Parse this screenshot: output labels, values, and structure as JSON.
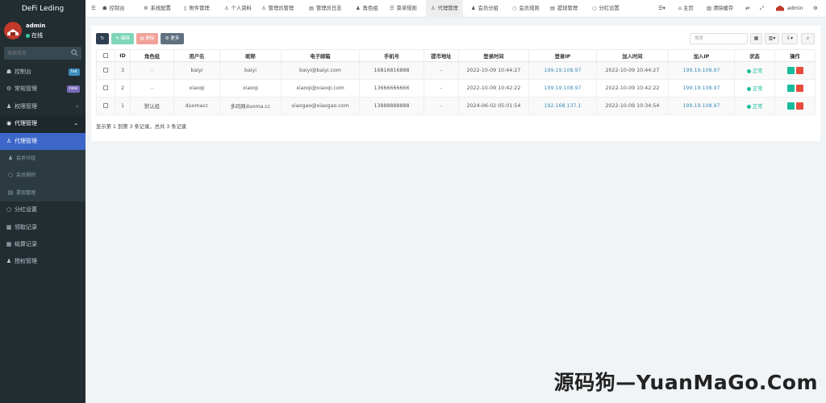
{
  "app": {
    "brand": "DeFi Leding"
  },
  "user": {
    "name": "admin",
    "status": "在线"
  },
  "sidebar": {
    "search_placeholder": "搜索菜单",
    "items": [
      {
        "label": "控制台",
        "icon": "dashboard-icon",
        "badge": "hot"
      },
      {
        "label": "常规管理",
        "icon": "gears-icon",
        "badge": "new"
      },
      {
        "label": "权限管理",
        "icon": "group-icon",
        "chevron": "‹"
      },
      {
        "label": "代理管理",
        "icon": "user-circle-icon",
        "chevron": "⌄"
      },
      {
        "label": "代理管理",
        "icon": "user-icon",
        "active": true
      },
      {
        "label": "会员分组",
        "icon": "users-icon",
        "sub": true
      },
      {
        "label": "会员规则",
        "icon": "circle-icon",
        "sub": true
      },
      {
        "label": "提现管理",
        "icon": "list-icon",
        "sub": true
      },
      {
        "label": "分红设置",
        "icon": "circle-icon"
      },
      {
        "label": "领取记录",
        "icon": "table-icon"
      },
      {
        "label": "结算记录",
        "icon": "table-icon"
      },
      {
        "label": "授权管理",
        "icon": "users-icon"
      }
    ]
  },
  "topnav": {
    "tabs": [
      "控制台",
      "系统配置",
      "附件管理",
      "个人资料",
      "管理员管理",
      "管理员日志",
      "角色组",
      "菜单规则",
      "代理管理",
      "会员分组",
      "会员规则",
      "提现管理",
      "分红设置"
    ],
    "active_tab": 8,
    "right": {
      "home": "主页",
      "clear": "清除缓存",
      "user": "admin"
    }
  },
  "toolbar": {
    "edit": "编辑",
    "delete": "删除",
    "more": "更多",
    "search_placeholder": "搜索"
  },
  "table": {
    "columns": [
      "ID",
      "角色组",
      "用户名",
      "昵称",
      "电子邮箱",
      "手机号",
      "提币地址",
      "登录时间",
      "登录IP",
      "加入时间",
      "加入IP",
      "状态",
      "操作"
    ],
    "rows": [
      [
        "3",
        "-",
        "baiyi",
        "baiyi",
        "baiyi@baiyi.com",
        "16816816888",
        "-",
        "2022-10-09 10:44:27",
        "199.19.108.97",
        "2022-10-09 10:44:27",
        "199.19.108.97",
        "正常"
      ],
      [
        "2",
        "-",
        "xiaoqi",
        "xiaoqi",
        "xiaoqi@xiaoqi.com",
        "13666666666",
        "-",
        "2022-10-09 10:42:22",
        "199.19.108.97",
        "2022-10-09 10:42:22",
        "199.19.108.97",
        "正常"
      ],
      [
        "1",
        "默认组",
        "duomacc",
        "多码网duoma.cc",
        "xiaogao@xiaogao.com",
        "13888888888",
        "-",
        "2024-06-02 05:01:54",
        "192.168.137.1",
        "2022-10-09 10:34:54",
        "199.19.108.97",
        "正常"
      ]
    ]
  },
  "pager": "显示第 1 到第 3 条记录，总共 3 条记录",
  "watermark": "源码狗—YuanMaGo.Com",
  "colors": {
    "sidebar": "#222d32",
    "active": "#3c66c9",
    "success": "#18bc9c",
    "danger": "#e74c3c"
  }
}
